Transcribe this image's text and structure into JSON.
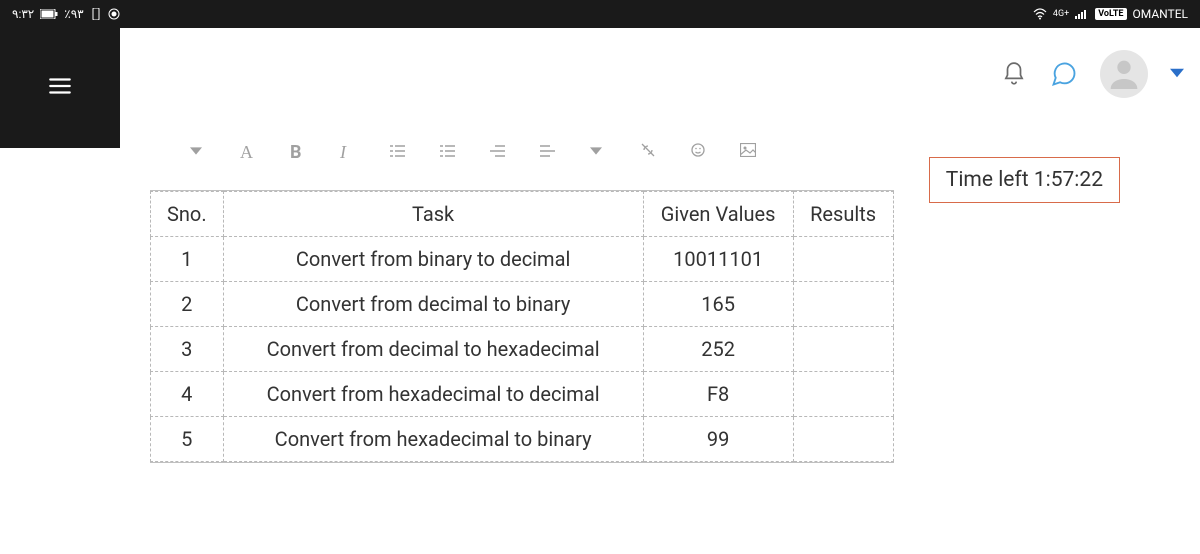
{
  "status": {
    "time": "٩:٣٢",
    "battery": "٪٩٣",
    "lte": "4G+",
    "volte": "VoLTE",
    "carrier": "OMANTEL"
  },
  "timer": {
    "label": "Time left 1:57:22"
  },
  "table": {
    "headers": {
      "sno": "Sno.",
      "task": "Task",
      "given": "Given Values",
      "results": "Results"
    },
    "rows": [
      {
        "sno": "1",
        "task": "Convert from binary to decimal",
        "given": "10011101",
        "results": ""
      },
      {
        "sno": "2",
        "task": "Convert from decimal to binary",
        "given": "165",
        "results": ""
      },
      {
        "sno": "3",
        "task": "Convert from decimal to hexadecimal",
        "given": "252",
        "results": ""
      },
      {
        "sno": "4",
        "task": "Convert from hexadecimal to decimal",
        "given": "F8",
        "results": ""
      },
      {
        "sno": "5",
        "task": "Convert from hexadecimal to binary",
        "given": "99",
        "results": ""
      }
    ]
  }
}
